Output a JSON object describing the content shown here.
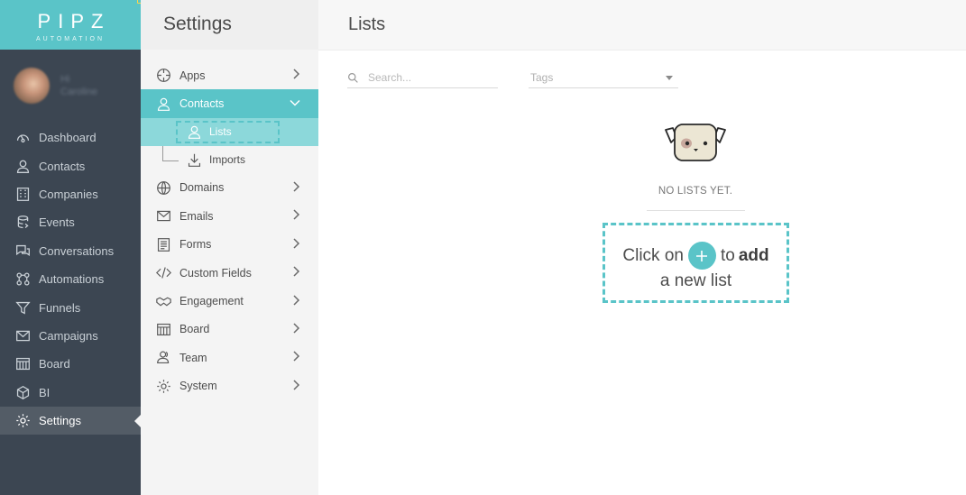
{
  "brand": {
    "name": "PIPZ",
    "tagline": "AUTOMATION"
  },
  "profile": {
    "line1": "Hi",
    "line2": "Caroline"
  },
  "nav": {
    "items": [
      {
        "label": "Dashboard",
        "icon": "dashboard-icon"
      },
      {
        "label": "Contacts",
        "icon": "user-icon"
      },
      {
        "label": "Companies",
        "icon": "building-icon"
      },
      {
        "label": "Events",
        "icon": "events-icon"
      },
      {
        "label": "Conversations",
        "icon": "chat-icon"
      },
      {
        "label": "Automations",
        "icon": "automations-icon"
      },
      {
        "label": "Funnels",
        "icon": "funnel-icon"
      },
      {
        "label": "Campaigns",
        "icon": "mail-icon"
      },
      {
        "label": "Board",
        "icon": "board-icon"
      },
      {
        "label": "BI",
        "icon": "cube-icon"
      },
      {
        "label": "Settings",
        "icon": "gear-icon",
        "active": true
      }
    ]
  },
  "settings": {
    "title": "Settings",
    "menu": [
      {
        "label": "Apps",
        "icon": "apps-icon"
      },
      {
        "label": "Contacts",
        "icon": "user-icon",
        "open": true
      },
      {
        "label": "Domains",
        "icon": "globe-icon"
      },
      {
        "label": "Emails",
        "icon": "mail-icon"
      },
      {
        "label": "Forms",
        "icon": "form-icon"
      },
      {
        "label": "Custom Fields",
        "icon": "code-icon"
      },
      {
        "label": "Engagement",
        "icon": "handshake-icon"
      },
      {
        "label": "Board",
        "icon": "board-icon"
      },
      {
        "label": "Team",
        "icon": "team-icon"
      },
      {
        "label": "System",
        "icon": "gear-icon"
      }
    ],
    "submenu": [
      {
        "label": "Lists",
        "icon": "lists-user-icon",
        "selected": true
      },
      {
        "label": "Imports",
        "icon": "download-icon"
      }
    ]
  },
  "main": {
    "title": "Lists",
    "search_placeholder": "Search...",
    "tags_placeholder": "Tags",
    "empty_state": "NO LISTS YET.",
    "cta": {
      "prefix": "Click on",
      "middle": "to",
      "action": "add",
      "suffix": "a new list"
    }
  },
  "colors": {
    "accent": "#5ac4c8",
    "sidebar": "#3c4652",
    "panel": "#f4f4f4"
  }
}
